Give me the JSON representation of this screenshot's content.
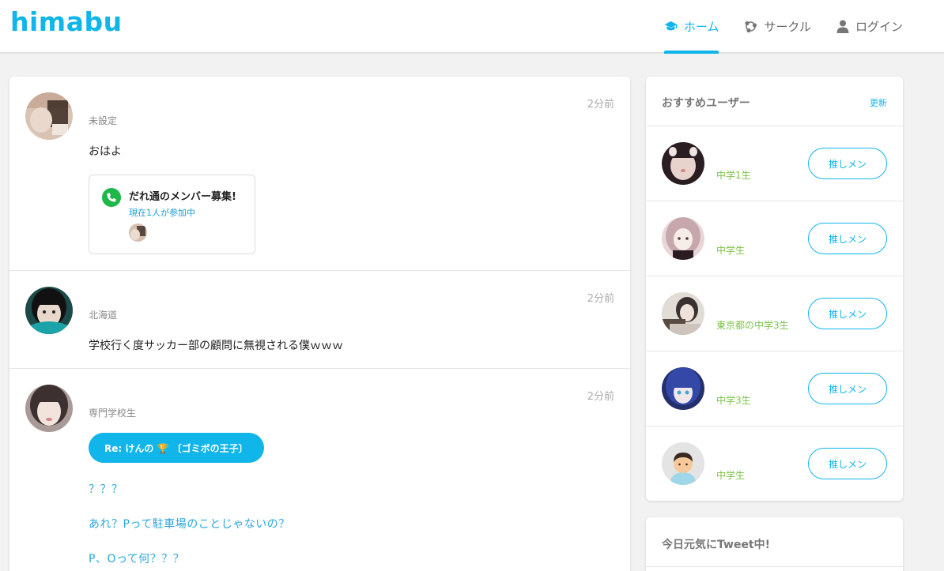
{
  "header": {
    "logo": "himabu",
    "nav": [
      {
        "label": "ホーム",
        "icon": "graduation-cap-icon",
        "active": true
      },
      {
        "label": "サークル",
        "icon": "circle-nodes-icon",
        "active": false
      },
      {
        "label": "ログイン",
        "icon": "user-icon",
        "active": false
      }
    ]
  },
  "feed": {
    "posts": [
      {
        "time": "2分前",
        "region": "未設定",
        "text": "おはよ",
        "call": {
          "title": "だれ通のメンバー募集!",
          "sub": "現在1人が参加中"
        }
      },
      {
        "time": "2分前",
        "region": "北海道",
        "text": "学校行く度サッカー部の顧問に無視される僕ｗｗｗ"
      },
      {
        "time": "2分前",
        "region": "専門学校生",
        "reply": "Re: けんの 🏆 〔ゴミボの王子〕",
        "lines": [
          "？？？",
          "あれ？Pって駐車場のことじゃないの？",
          "P、Oって何？？？"
        ]
      }
    ]
  },
  "sidebar": {
    "title": "おすすめユーザー",
    "refresh": "更新",
    "users": [
      {
        "grade": "中学1生",
        "button": "推しメン"
      },
      {
        "grade": "中学生",
        "button": "推しメン"
      },
      {
        "grade": "東京都の中学3生",
        "button": "推しメン"
      },
      {
        "grade": "中学3生",
        "button": "推しメン"
      },
      {
        "grade": "中学生",
        "button": "推しメン"
      }
    ]
  },
  "tweet_box": {
    "title": "今日元気にTweet中!"
  },
  "colors": {
    "accent": "#10b5ea",
    "green": "#7cc34a",
    "call_green": "#1fb74a"
  }
}
